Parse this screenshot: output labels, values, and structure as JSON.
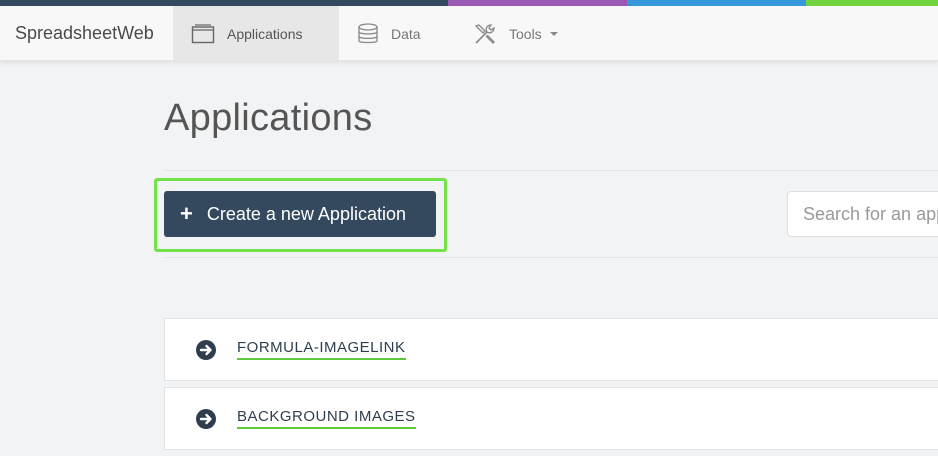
{
  "brand": {
    "name": "SpreadsheetWeb"
  },
  "colorbar": [
    "#34495e",
    "#9b59b6",
    "#3498db",
    "#71d43f"
  ],
  "nav": {
    "applications": "Applications",
    "data": "Data",
    "tools": "Tools"
  },
  "page": {
    "title": "Applications"
  },
  "actions": {
    "create_label": "Create a new Application",
    "search_placeholder": "Search for an applica"
  },
  "applications": [
    {
      "name": "FORMULA-IMAGELINK"
    },
    {
      "name": "BACKGROUND IMAGES"
    }
  ],
  "colors": {
    "primary_button": "#34495e",
    "highlight": "#76e24a",
    "underline": "#5cc93a"
  }
}
